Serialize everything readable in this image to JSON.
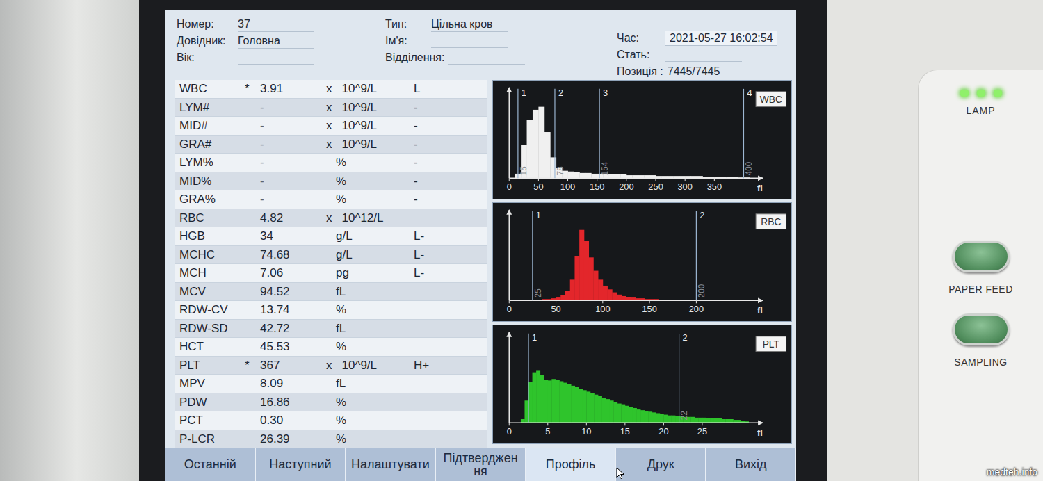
{
  "header": {
    "columns": [
      [
        {
          "label": "Номер:",
          "value": "37"
        },
        {
          "label": "Довідник:",
          "value": "Головна"
        },
        {
          "label": "Вік:",
          "value": ""
        }
      ],
      [
        {
          "label": "Тип:",
          "value": "Цільна кров"
        },
        {
          "label": "Ім'я:",
          "value": ""
        },
        {
          "label": "Відділення:",
          "value": ""
        }
      ],
      [
        {
          "label": "Час:",
          "value": "2021-05-27 16:02:54"
        },
        {
          "label": "Стать:",
          "value": ""
        },
        {
          "label": "Позиція :",
          "value": "7445/7445"
        }
      ]
    ]
  },
  "parameters": [
    {
      "name": "WBC",
      "mark": "*",
      "value": "3.91",
      "multiplier": "x",
      "unit": "10^9/L",
      "flag": "L"
    },
    {
      "name": "LYM#",
      "mark": "",
      "value": "-",
      "multiplier": "x",
      "unit": "10^9/L",
      "flag": "-"
    },
    {
      "name": "MID#",
      "mark": "",
      "value": "-",
      "multiplier": "x",
      "unit": "10^9/L",
      "flag": "-"
    },
    {
      "name": "GRA#",
      "mark": "",
      "value": "-",
      "multiplier": "x",
      "unit": "10^9/L",
      "flag": "-"
    },
    {
      "name": "LYM%",
      "mark": "",
      "value": "-",
      "multiplier": "",
      "unit": "%",
      "flag": "-"
    },
    {
      "name": "MID%",
      "mark": "",
      "value": "-",
      "multiplier": "",
      "unit": "%",
      "flag": "-"
    },
    {
      "name": "GRA%",
      "mark": "",
      "value": "-",
      "multiplier": "",
      "unit": "%",
      "flag": "-"
    },
    {
      "name": "RBC",
      "mark": "",
      "value": "4.82",
      "multiplier": "x",
      "unit": "10^12/L",
      "flag": ""
    },
    {
      "name": "HGB",
      "mark": "",
      "value": "34",
      "multiplier": "",
      "unit": "g/L",
      "flag": "L-"
    },
    {
      "name": "MCHC",
      "mark": "",
      "value": "74.68",
      "multiplier": "",
      "unit": "g/L",
      "flag": "L-"
    },
    {
      "name": "MCH",
      "mark": "",
      "value": "7.06",
      "multiplier": "",
      "unit": "pg",
      "flag": "L-"
    },
    {
      "name": "MCV",
      "mark": "",
      "value": "94.52",
      "multiplier": "",
      "unit": "fL",
      "flag": ""
    },
    {
      "name": "RDW-CV",
      "mark": "",
      "value": "13.74",
      "multiplier": "",
      "unit": "%",
      "flag": ""
    },
    {
      "name": "RDW-SD",
      "mark": "",
      "value": "42.72",
      "multiplier": "",
      "unit": "fL",
      "flag": ""
    },
    {
      "name": "HCT",
      "mark": "",
      "value": "45.53",
      "multiplier": "",
      "unit": "%",
      "flag": ""
    },
    {
      "name": "PLT",
      "mark": "*",
      "value": "367",
      "multiplier": "x",
      "unit": "10^9/L",
      "flag": "H+"
    },
    {
      "name": "MPV",
      "mark": "",
      "value": "8.09",
      "multiplier": "",
      "unit": "fL",
      "flag": ""
    },
    {
      "name": "PDW",
      "mark": "",
      "value": "16.86",
      "multiplier": "",
      "unit": "%",
      "flag": ""
    },
    {
      "name": "PCT",
      "mark": "",
      "value": "0.30",
      "multiplier": "",
      "unit": "%",
      "flag": ""
    },
    {
      "name": "P-LCR",
      "mark": "",
      "value": "26.39",
      "multiplier": "",
      "unit": "%",
      "flag": ""
    }
  ],
  "charts": [
    {
      "title": "WBC",
      "color": "#f0f0f0",
      "x_max": 415,
      "bin_width": 10,
      "unit": "fl",
      "ticks": [
        "0",
        "50",
        "100",
        "150",
        "200",
        "250",
        "300",
        "350"
      ],
      "markers": [
        {
          "number": "1",
          "label": "15",
          "at": 15
        },
        {
          "number": "2",
          "label": "78",
          "at": 78
        },
        {
          "number": "3",
          "label": "154",
          "at": 154
        },
        {
          "number": "4",
          "label": "400",
          "at": 400
        }
      ],
      "values": [
        0,
        6,
        45,
        78,
        92,
        96,
        62,
        28,
        14,
        10,
        9,
        8,
        7,
        7,
        6,
        6,
        5,
        5,
        5,
        5,
        4,
        4,
        4,
        4,
        4,
        3,
        3,
        3,
        3,
        3,
        3,
        3,
        3,
        2,
        2,
        2,
        2,
        2,
        2,
        1,
        1
      ]
    },
    {
      "title": "RBC",
      "color": "#e3262b",
      "x_max": 260,
      "bin_width": 5,
      "unit": "fl",
      "ticks": [
        "0",
        "50",
        "100",
        "150",
        "200"
      ],
      "markers": [
        {
          "number": "1",
          "label": "25",
          "at": 25
        },
        {
          "number": "2",
          "label": "200",
          "at": 200
        }
      ],
      "values": [
        0,
        0,
        0,
        0,
        0,
        1,
        1,
        2,
        2,
        3,
        4,
        7,
        13,
        28,
        60,
        95,
        80,
        58,
        40,
        28,
        20,
        15,
        11,
        8,
        6,
        5,
        4,
        3,
        3,
        2,
        2,
        2,
        1,
        1,
        1,
        1,
        0,
        0,
        0,
        0
      ]
    },
    {
      "title": "PLT",
      "color": "#2fc42c",
      "x_max": 31.5,
      "bin_width": 0.5,
      "unit": "fl",
      "ticks": [
        "0",
        "5",
        "10",
        "15",
        "20",
        "25"
      ],
      "markers": [
        {
          "number": "1",
          "label": "",
          "at": 2.5
        },
        {
          "number": "2",
          "label": "22",
          "at": 22
        }
      ],
      "values": [
        0,
        0,
        0,
        5,
        30,
        55,
        68,
        70,
        64,
        58,
        57,
        59,
        58,
        56,
        54,
        52,
        50,
        48,
        46,
        44,
        42,
        40,
        38,
        36,
        34,
        32,
        30,
        28,
        26,
        25,
        23,
        21,
        20,
        18,
        17,
        16,
        15,
        14,
        13,
        12,
        11,
        10,
        10,
        9,
        9,
        8,
        8,
        8,
        7,
        7,
        7,
        6,
        6,
        6,
        6,
        5,
        5,
        5,
        4,
        4,
        3,
        2
      ]
    }
  ],
  "toolbar": [
    {
      "lines": [
        "Останній"
      ],
      "selected": false
    },
    {
      "lines": [
        "Наступний"
      ],
      "selected": false
    },
    {
      "lines": [
        "Налаштувати"
      ],
      "selected": false
    },
    {
      "lines": [
        "Підтверджен",
        "ня"
      ],
      "selected": false
    },
    {
      "lines": [
        "Профіль"
      ],
      "selected": true
    },
    {
      "lines": [
        "Друк"
      ],
      "selected": false
    },
    {
      "lines": [
        "Вихід"
      ],
      "selected": false
    }
  ],
  "right_panel": {
    "lamp": {
      "label": "LAMP",
      "leds": [
        {
          "on": true
        },
        {
          "on": true
        },
        {
          "on": true
        }
      ]
    },
    "buttons": [
      {
        "label": "PAPER FEED"
      },
      {
        "label": "SAMPLING"
      }
    ]
  },
  "watermark": "medteh.info"
}
